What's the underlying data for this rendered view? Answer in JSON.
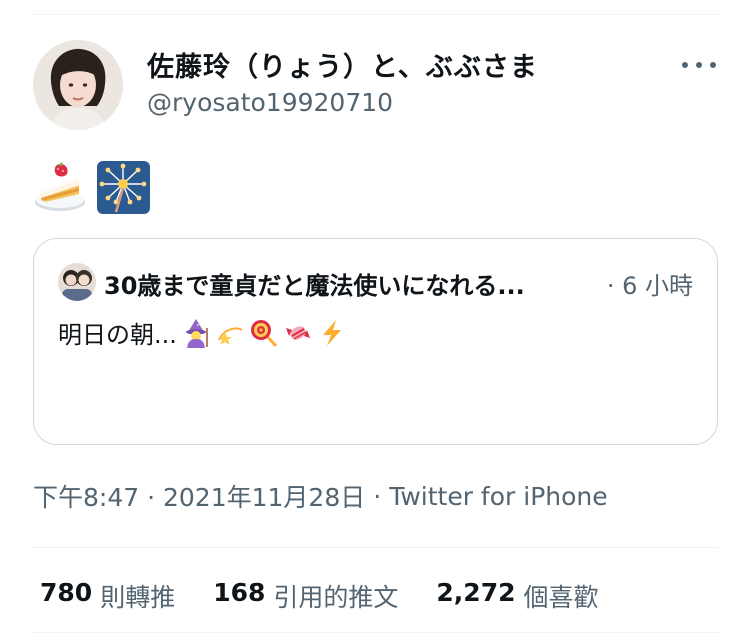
{
  "tweet": {
    "display_name": "佐藤玲（りょう）と、ぶぶさま",
    "handle": "@ryosato19920710",
    "emojis": [
      "shortcake-emoji",
      "sparkler-emoji"
    ],
    "quoted": {
      "name": "30歳まで童貞だと魔法使いになれる...",
      "time": "· 6 小時",
      "text": "明日の朝...",
      "emojis": [
        "mage-emoji",
        "dizzy-emoji",
        "lollipop-emoji",
        "candy-emoji",
        "high-voltage-emoji"
      ]
    },
    "timestamp": "下午8:47 · 2021年11月28日",
    "separator": "·",
    "source": "Twitter for iPhone",
    "stats": [
      {
        "num": "780",
        "label": "則轉推"
      },
      {
        "num": "168",
        "label": "引用的推文"
      },
      {
        "num": "2,272",
        "label": "個喜歡"
      }
    ]
  },
  "colors": {
    "text": "#0f1419",
    "secondary": "#536471",
    "border": "#cfd9de",
    "divider": "#eff3f4"
  }
}
